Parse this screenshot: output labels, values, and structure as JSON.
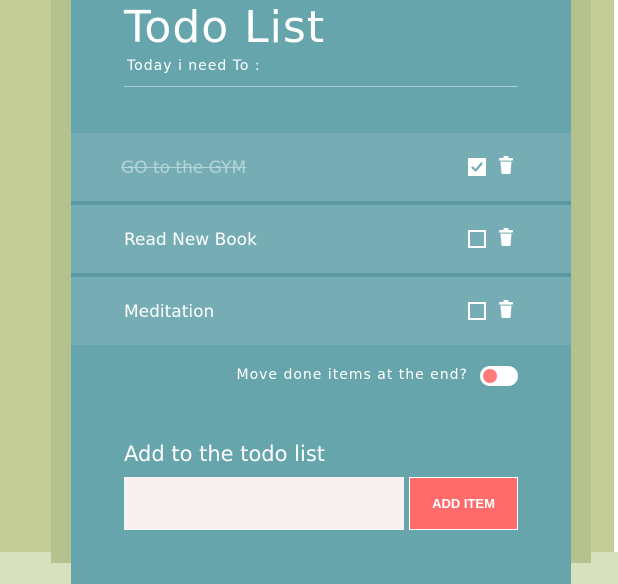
{
  "header": {
    "title": "Todo List",
    "subtitle": "Today i need To :"
  },
  "todos": [
    {
      "text": "GO to the GYM",
      "done": true,
      "checkbox_icon": "checked-box-icon",
      "delete_icon": "trash-icon"
    },
    {
      "text": "Read New Book",
      "done": false,
      "checkbox_icon": "empty-box-icon",
      "delete_icon": "trash-icon"
    },
    {
      "text": "Meditation",
      "done": false,
      "checkbox_icon": "empty-box-icon",
      "delete_icon": "trash-icon"
    }
  ],
  "settings": {
    "move_done_label": "Move done items at the end?",
    "move_done_enabled": false
  },
  "add_form": {
    "heading": "Add to the todo list",
    "input_value": "",
    "input_placeholder": "",
    "button_label": "ADD ITEM"
  },
  "colors": {
    "background": "#c5cd97",
    "card": "#67a5ad",
    "item": "#76adb4",
    "accent": "#ff6b6b",
    "input_bg": "#f7f1f1"
  }
}
